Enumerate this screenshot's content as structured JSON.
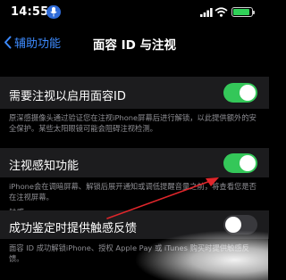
{
  "status_bar": {
    "time": "14:55",
    "accent_color": "#2f6bd8",
    "battery_color": "#30d158",
    "icons": [
      "microphone-icon",
      "signal-icon",
      "wifi-icon",
      "battery-icon"
    ]
  },
  "nav": {
    "back_label": "辅助功能",
    "title": "面容 ID 与注视"
  },
  "settings": {
    "require_attention": {
      "label": "需要注视以启用面容ID",
      "enabled": true,
      "footer": "原深感摄像头通过验证您在注视iPhone屏幕后进行解锁，以此提供额外的安全保护。某些太阳眼镜可能会阻碍注视检测。"
    },
    "attention_aware": {
      "label": "注视感知功能",
      "enabled": true,
      "footer": "iPhone会在调暗屏幕、解锁后展开通知或调低提醒音量之前，将查看您是否在注视屏幕。"
    },
    "haptics_header": "触感",
    "haptic_success": {
      "label": "成功鉴定时提供触感反馈",
      "enabled": false,
      "footer": "面容 ID 成功解锁iPhone、授权 Apple Pay 或 iTunes 购买时提供触感反馈。"
    }
  },
  "colors": {
    "toggle_on": "#34c759",
    "link": "#3d8bff",
    "annotation_arrow": "#e0262b"
  }
}
